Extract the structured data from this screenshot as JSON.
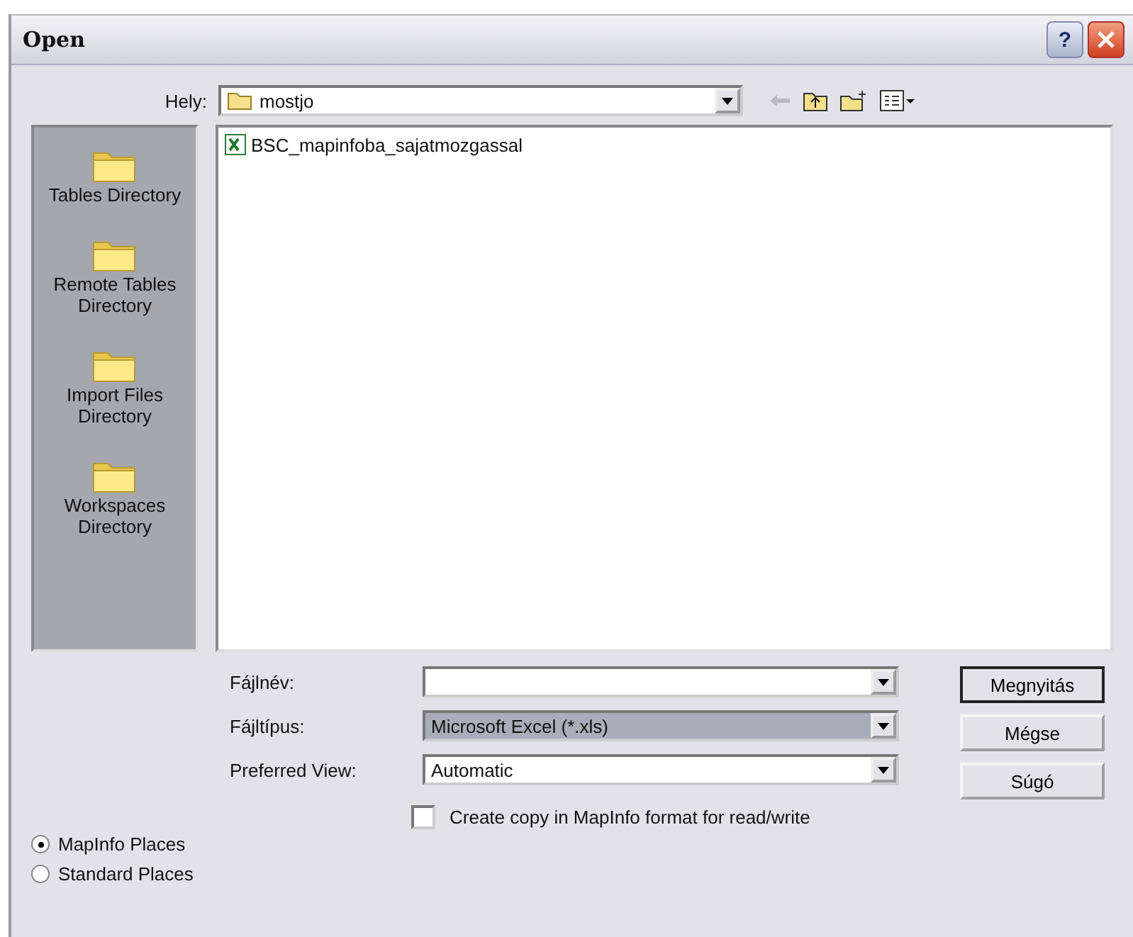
{
  "window": {
    "title": "Open",
    "help_button": "?"
  },
  "location": {
    "label": "Hely:",
    "value": "mostjo"
  },
  "places": [
    {
      "label": "Tables Directory"
    },
    {
      "label": "Remote Tables Directory"
    },
    {
      "label": "Import Files Directory"
    },
    {
      "label": "Workspaces Directory"
    }
  ],
  "files": [
    {
      "name": "BSC_mapinfoba_sajatmozgassal",
      "selected": false
    }
  ],
  "fields": [
    {
      "label": "Fájlnév:",
      "highlighted": false
    },
    {
      "label": "Fájltípus:",
      "value": "Microsoft Excel (*.xls)",
      "highlighted": true
    },
    {
      "label": "Preferred View:",
      "value": "Automatic",
      "highlighted": false
    }
  ],
  "buttons": [
    {
      "label": "Megnyitás",
      "default": true
    },
    {
      "label": "Mégse",
      "default": false
    },
    {
      "label": "Súgó",
      "default": false
    }
  ],
  "copy_option": {
    "label": "Create copy in MapInfo format for read/write",
    "checked": false
  },
  "place_sets": [
    {
      "label": "MapInfo Places",
      "selected": true
    },
    {
      "label": "Standard Places",
      "selected": false
    }
  ]
}
